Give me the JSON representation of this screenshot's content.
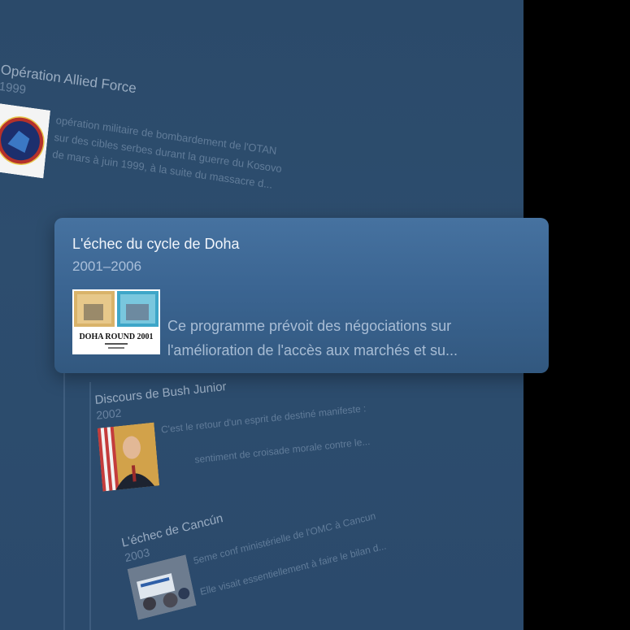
{
  "timeline": {
    "items": [
      {
        "title": "Opération Allied Force",
        "year": "1999",
        "description_lines": [
          "opération militaire de bombardement de l'OTAN",
          "sur des cibles serbes durant la guerre du Kosovo",
          "de mars à juin 1999, à la suite du massacre d..."
        ],
        "image": "nato-emblem"
      },
      {
        "title": "L'échec du cycle de Doha",
        "year": "2001–2006",
        "description_lines": [
          "Ce programme prévoit des négociations sur",
          "l'amélioration de l'accès aux marchés et su..."
        ],
        "image": "doha-round-stamps",
        "image_caption": "DOHA ROUND 2001",
        "focused": true
      },
      {
        "title": "Discours de Bush Junior",
        "year": "2002",
        "description_lines": [
          "C'est le retour d'un esprit de destiné manifeste :",
          "sentiment de croisade morale contre le..."
        ],
        "image": "president-portrait"
      },
      {
        "title": "L'échec de Cancún",
        "year": "2003",
        "description_lines": [
          "5eme conf ministérielle de l'OMC à Cancun",
          "Elle visait essentiellement à faire le bilan d..."
        ],
        "image": "protest-photo"
      }
    ]
  },
  "colors": {
    "background": "#2b4a6a",
    "focused_card": "#3b6592",
    "outside": "#000000"
  }
}
